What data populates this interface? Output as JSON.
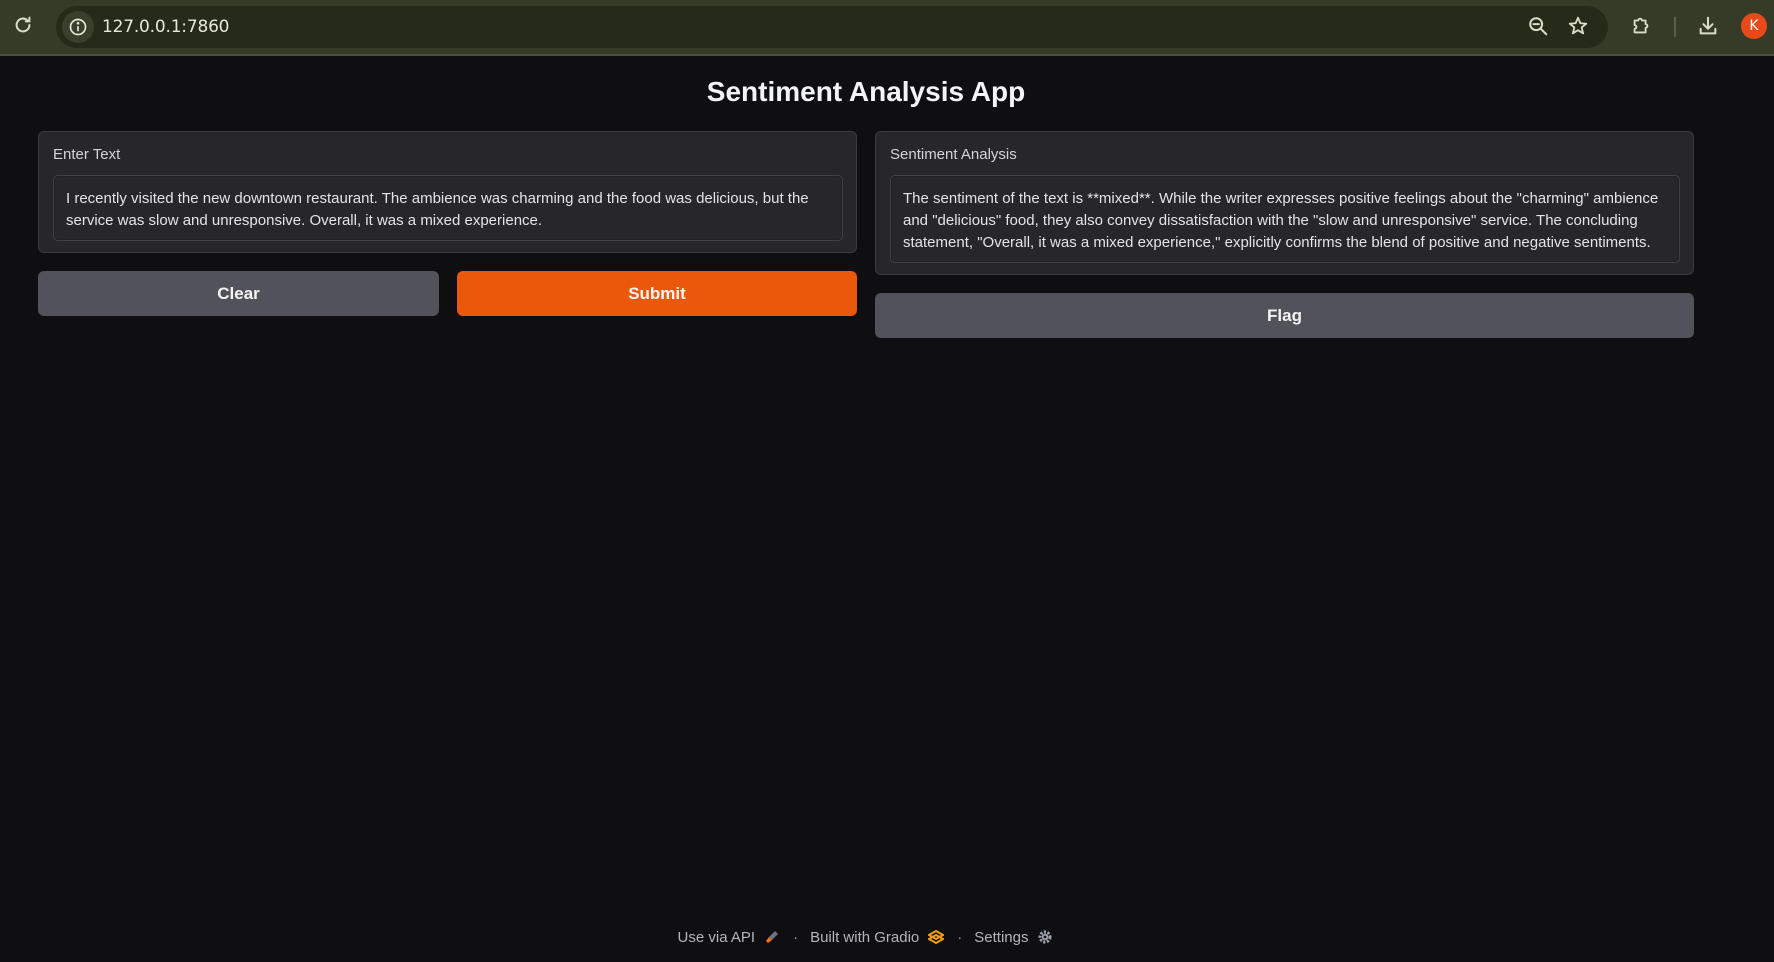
{
  "browser": {
    "url": "127.0.0.1:7860",
    "avatar_initial": "K",
    "icons": [
      "reload-icon",
      "site-info-icon",
      "zoom-out-icon",
      "bookmark-star-icon",
      "extensions-icon",
      "download-icon"
    ]
  },
  "app": {
    "title": "Sentiment Analysis App",
    "input_panel": {
      "label": "Enter Text",
      "value": "I recently visited the new downtown restaurant. The ambience was charming and the food was delicious, but the service was slow and unresponsive. Overall, it was a mixed experience."
    },
    "output_panel": {
      "label": "Sentiment Analysis",
      "value": "The sentiment of the text is **mixed**. While the writer expresses positive feelings about the \"charming\" ambience and \"delicious\" food, they also convey dissatisfaction with the \"slow and unresponsive\" service. The concluding statement, \"Overall, it was a mixed experience,\" explicitly confirms the blend of positive and negative sentiments."
    },
    "buttons": {
      "clear": "Clear",
      "submit": "Submit",
      "flag": "Flag"
    },
    "colors": {
      "primary": "#ea580c",
      "secondary": "#52525b",
      "background": "#0f0f11",
      "panel": "#27272a"
    }
  },
  "footer": {
    "api": "Use via API",
    "separator": "·",
    "built_with": "Built with Gradio",
    "settings": "Settings"
  }
}
